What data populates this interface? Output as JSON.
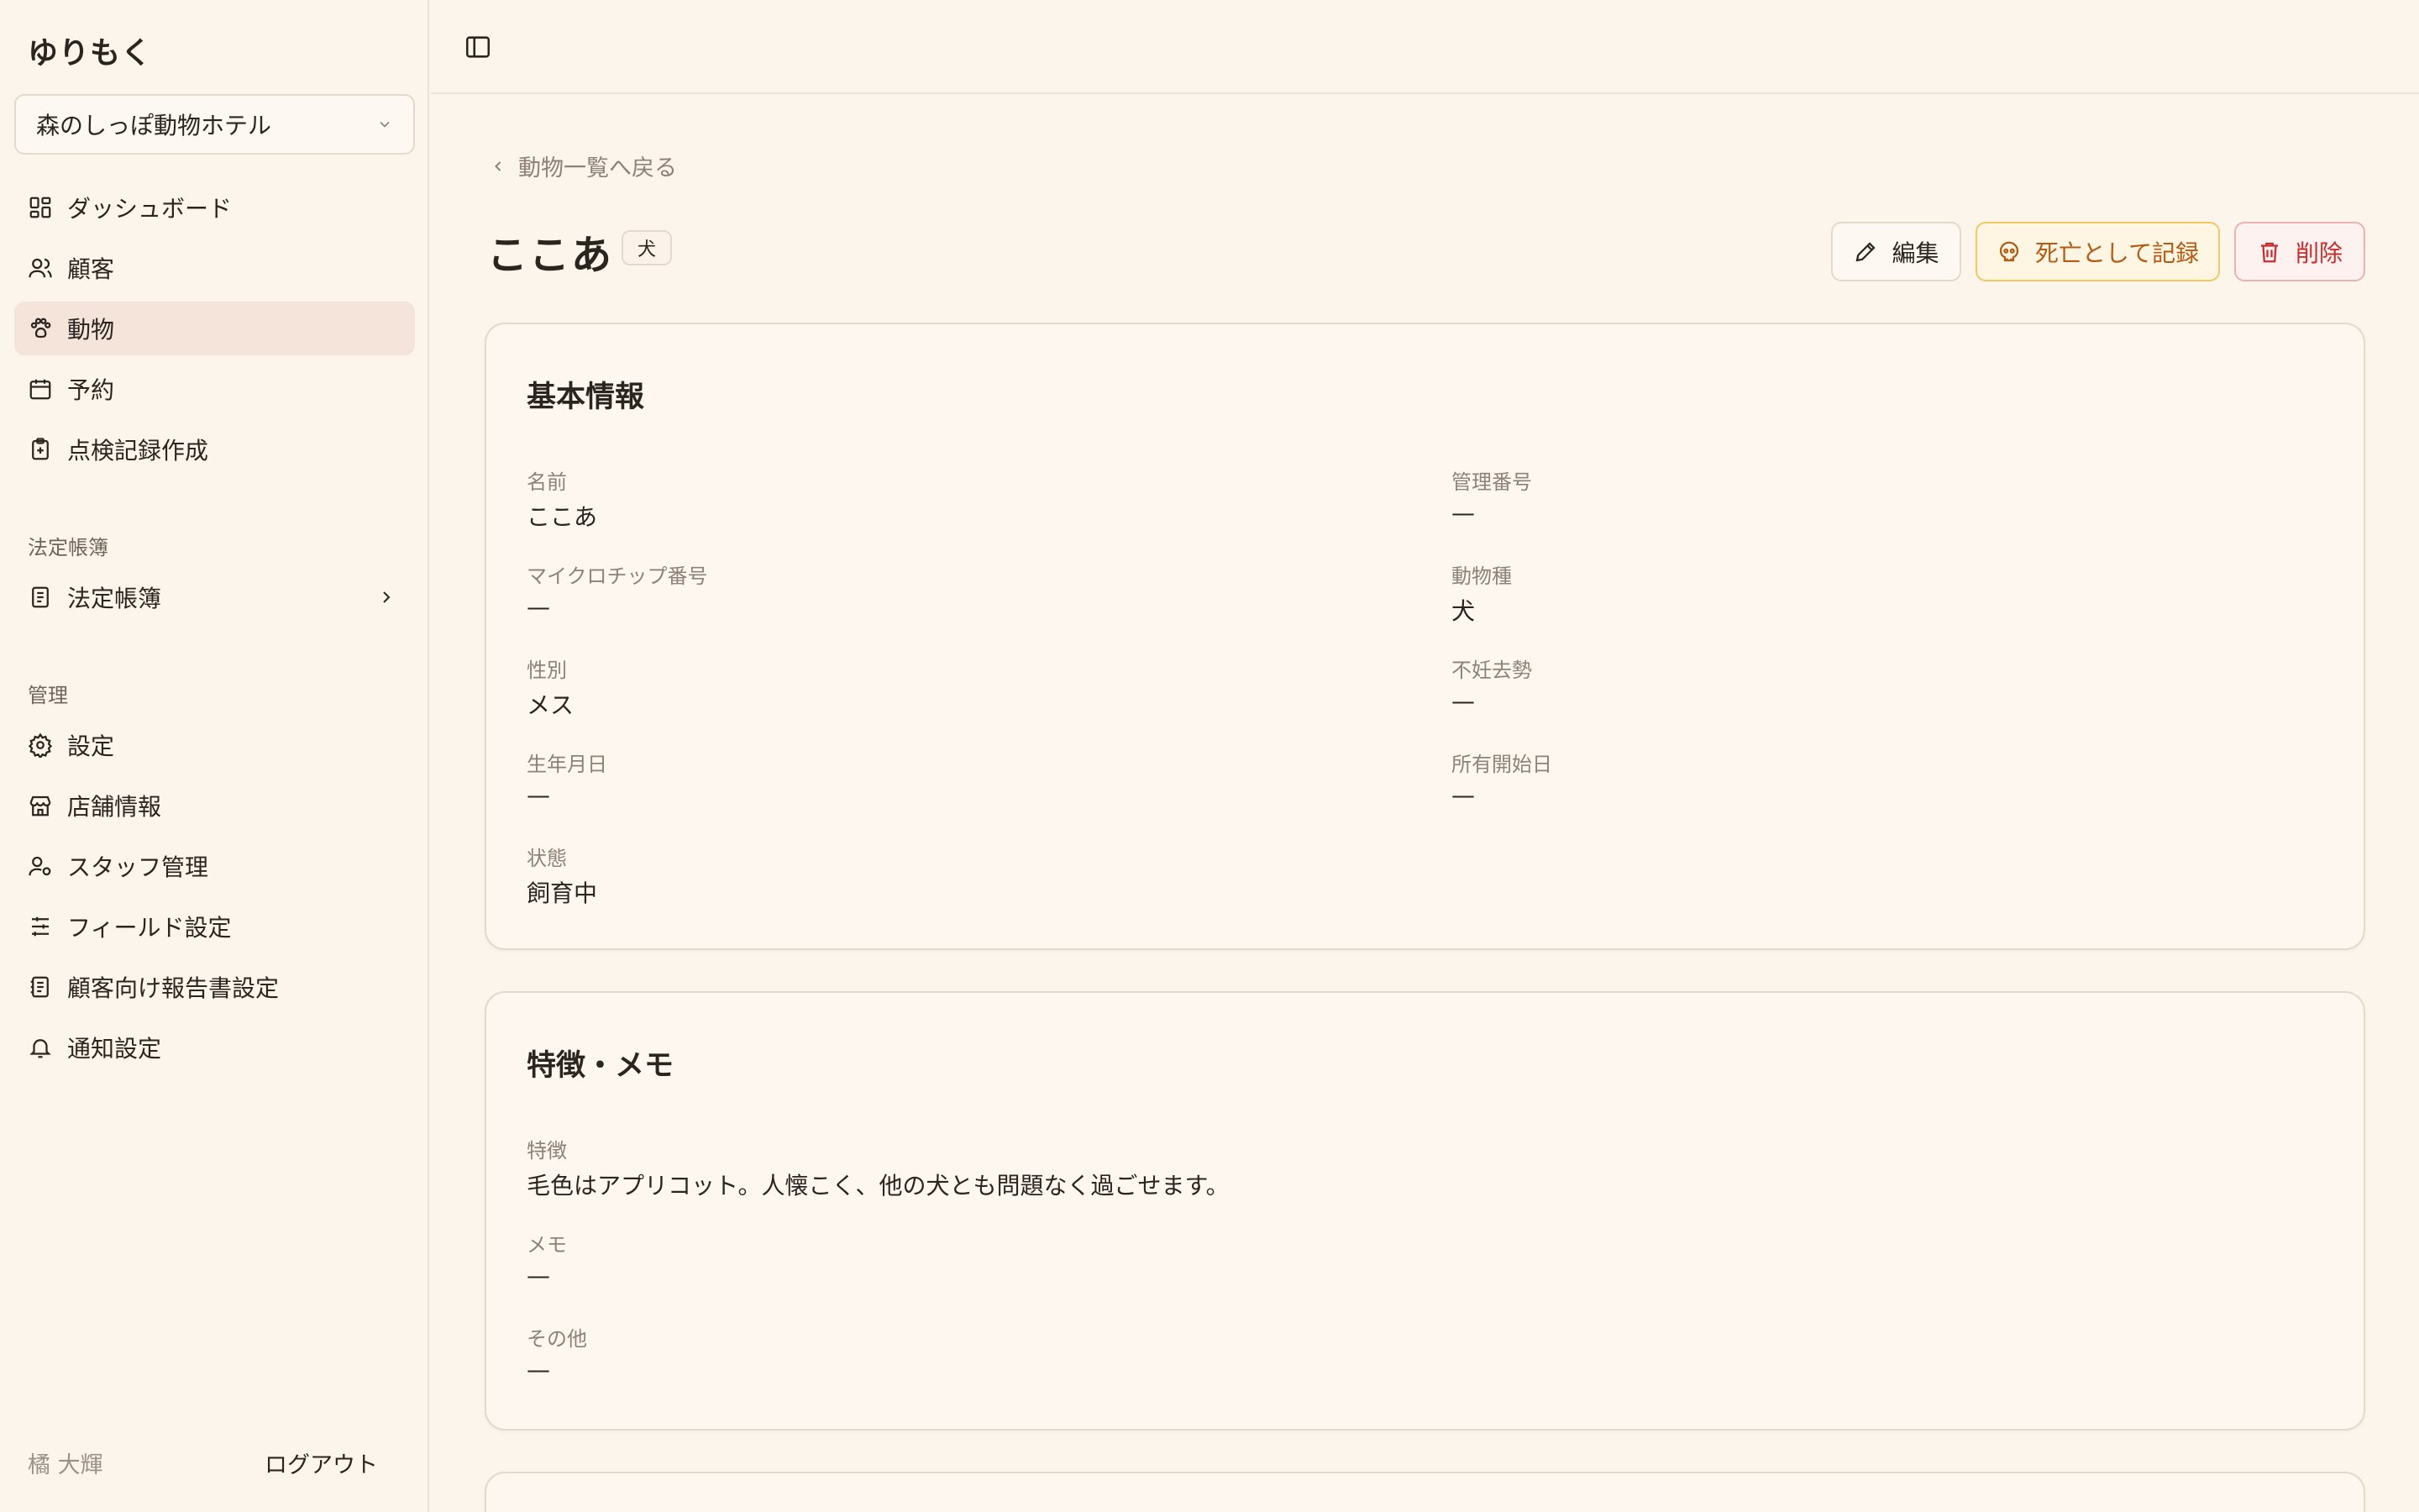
{
  "sidebar": {
    "brand": "ゆりもく",
    "store_select": "森のしっぽ動物ホテル",
    "nav": [
      {
        "label": "ダッシュボード",
        "icon": "dashboard-icon"
      },
      {
        "label": "顧客",
        "icon": "users-icon"
      },
      {
        "label": "動物",
        "icon": "paw-icon",
        "active": true
      },
      {
        "label": "予約",
        "icon": "calendar-icon"
      },
      {
        "label": "点検記録作成",
        "icon": "clipboard-icon"
      }
    ],
    "section_ledger": "法定帳簿",
    "ledger_item": "法定帳簿",
    "section_admin": "管理",
    "admin": [
      {
        "label": "設定",
        "icon": "gear-icon"
      },
      {
        "label": "店舗情報",
        "icon": "store-icon"
      },
      {
        "label": "スタッフ管理",
        "icon": "user-settings-icon"
      },
      {
        "label": "フィールド設定",
        "icon": "sliders-icon"
      },
      {
        "label": "顧客向け報告書設定",
        "icon": "report-icon"
      },
      {
        "label": "通知設定",
        "icon": "bell-icon"
      }
    ],
    "user": "橘 大輝",
    "logout": "ログアウト"
  },
  "main": {
    "back": "動物一覧へ戻る",
    "title": "ここあ",
    "badge": "犬",
    "buttons": {
      "edit": "編集",
      "death": "死亡として記録",
      "delete": "削除"
    },
    "basic": {
      "title": "基本情報",
      "fields": [
        {
          "label": "名前",
          "value": "ここあ"
        },
        {
          "label": "管理番号",
          "value": "—"
        },
        {
          "label": "マイクロチップ番号",
          "value": "—"
        },
        {
          "label": "動物種",
          "value": "犬"
        },
        {
          "label": "性別",
          "value": "メス"
        },
        {
          "label": "不妊去勢",
          "value": "—"
        },
        {
          "label": "生年月日",
          "value": "—"
        },
        {
          "label": "所有開始日",
          "value": "—"
        },
        {
          "label": "状態",
          "value": "飼育中"
        }
      ]
    },
    "notes": {
      "title": "特徴・メモ",
      "fields": [
        {
          "label": "特徴",
          "value": "毛色はアプリコット。人懐こく、他の犬とも問題なく過ごせます。"
        },
        {
          "label": "メモ",
          "value": "—"
        },
        {
          "label": "その他",
          "value": "—"
        }
      ]
    }
  },
  "colors": {
    "background": "#fcf5ec",
    "active_nav": "#f5e4da",
    "warning": "#b45a13",
    "danger": "#c82d2d"
  }
}
